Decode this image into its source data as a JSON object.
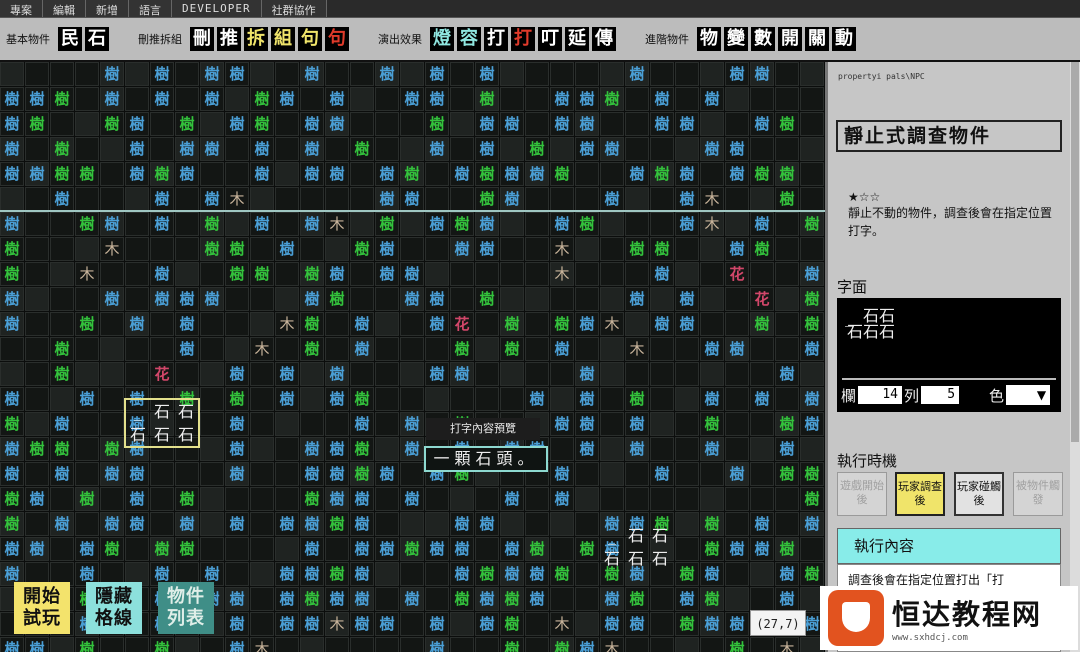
{
  "menu": [
    "專案",
    "編輯",
    "新增",
    "語言",
    "DEVELOPER",
    "社群協作"
  ],
  "toolbar": {
    "groups": [
      {
        "label": "基本物件",
        "buttons": [
          {
            "ch": "民",
            "color": "#ffffff"
          },
          {
            "ch": "石",
            "color": "#ffffff"
          }
        ]
      },
      {
        "label": "刪推拆組",
        "buttons": [
          {
            "ch": "刪",
            "color": "#ffffff"
          },
          {
            "ch": "推",
            "color": "#ffffff"
          },
          {
            "ch": "拆",
            "color": "#f0e46a"
          },
          {
            "ch": "組",
            "color": "#f0e46a"
          },
          {
            "ch": "句",
            "color": "#f0e46a"
          },
          {
            "ch": "句",
            "color": "#e03a2a"
          }
        ]
      },
      {
        "label": "演出效果",
        "buttons": [
          {
            "ch": "燈",
            "color": "#8fe6e0"
          },
          {
            "ch": "容",
            "color": "#8fe6e0"
          },
          {
            "ch": "打",
            "color": "#ffffff"
          },
          {
            "ch": "打",
            "color": "#e03a2a"
          },
          {
            "ch": "叮",
            "color": "#ffffff"
          },
          {
            "ch": "延",
            "color": "#ffffff"
          },
          {
            "ch": "傳",
            "color": "#ffffff"
          }
        ]
      },
      {
        "label": "進階物件",
        "buttons": [
          {
            "ch": "物",
            "color": "#ffffff"
          },
          {
            "ch": "變",
            "color": "#ffffff"
          },
          {
            "ch": "數",
            "color": "#ffffff"
          },
          {
            "ch": "開",
            "color": "#ffffff"
          },
          {
            "ch": "關",
            "color": "#ffffff"
          },
          {
            "ch": "動",
            "color": "#ffffff"
          }
        ]
      }
    ]
  },
  "grid": {
    "cols": 33,
    "rows": 24,
    "map": [
      "....B.B.BB..B..B.B.B.....B...BB..",
      "BBG.B.B.B.GB.B..BB.G..BBG.B.B....",
      "BG..GB.G.BG.BB...G.BB.BB..BB..BG.",
      "B.G..B.BB.B.B.G..B.B.G.BB...BB...",
      "BBGG.BGB..B.BB.BG.BGBBG..BGB.BGG.",
      "..B...B.BW.....BB..GB...B..BW..G.",
      "B..GB.B.G.B.BW.G.BGB..BG...BW.B.G",
      "G...W...GG.B..GB..BB..W..GG..BG..",
      "G..W..B..GG.GB.BB.....W...B..F..B",
      "B...B.BBB...BG..BB.G.....B.B..F.G",
      "B..G.B.B...WG.B..BF.G.GBW.BB..G.G",
      "..G....B..W.G.B...G.G.B..W..BB..B",
      "..G...F..B.B.B...BB....B.......B.",
      "B..B.B.G.G.B.BG......B.B.G..B.B.B",
      "G.B..B...B....B.B.G...BB.B..G..GB",
      "BGG.GB...B..BBG.B.B.BB.B.B..B..B.",
      "B.B.BB...B..BBGB.BG...B...B..B.GG",
      "GB.G.B.G....GBB.B...B.B.........G",
      "G.B.BB.B.B.BBGB...BB....BBG.G.B.B",
      "BB.BG.GG....B.BBGBB.BG.GB...GBBG.",
      "B..B..B.B..BBGB...BGBBG.GB.GB..BG",
      "..WGB.B.BB.BGBB.B.GBGB..BG.BG..B.",
      "..GB..BB.B.BBWBB.B.BG.W.BB.GBBG.B",
      "BB.G..G..BW......B..G.GBW....G.W."
    ],
    "legend": {
      "B": "樹",
      "G": "樹",
      "W": "木",
      "F": "花",
      ".": "_"
    },
    "stone_box": {
      "row1": [
        "_",
        "石",
        "石"
      ],
      "row2": [
        "石",
        "石",
        "石"
      ]
    },
    "stone_group2": {
      "row1": [
        "_",
        "石",
        "石"
      ],
      "row2": [
        "石",
        "石",
        "石"
      ]
    }
  },
  "preview": {
    "label": "打字內容預覽",
    "text": "一顆石頭。"
  },
  "buttons": {
    "start": "開始\n試玩",
    "hide": "隱藏\n格線",
    "list": "物件\n列表"
  },
  "coord": "(27,7)",
  "panel": {
    "subtitle": "propertyi  pals\\NPC",
    "title": "靜止式調查物件",
    "stars": "★☆☆",
    "desc": "靜止不動的物件，調查後會在指定位置打字。",
    "face_label": "字面",
    "face_lines": [
      "石石",
      "石石石"
    ],
    "field_col_label": "欄",
    "field_col_value": "14",
    "field_row_label": "列",
    "field_row_value": "5",
    "field_color_label": "色",
    "timing_label": "執行時機",
    "timing_buttons": [
      "遊戲開始後",
      "玩家調查後",
      "玩家碰觸後",
      "被物件觸發"
    ],
    "exec_head": "執行內容",
    "exec_body": "調查後會在指定位置打出「打"
  },
  "watermark": {
    "title": "恒达教程网",
    "url": "www.sxhdcj.com"
  },
  "colors": {
    "blue_tree": "#4a9fd6",
    "green_tree": "#33c23c",
    "wood": "#c7b39a",
    "flower": "#d2476a",
    "stone": "#e8e8e8"
  }
}
